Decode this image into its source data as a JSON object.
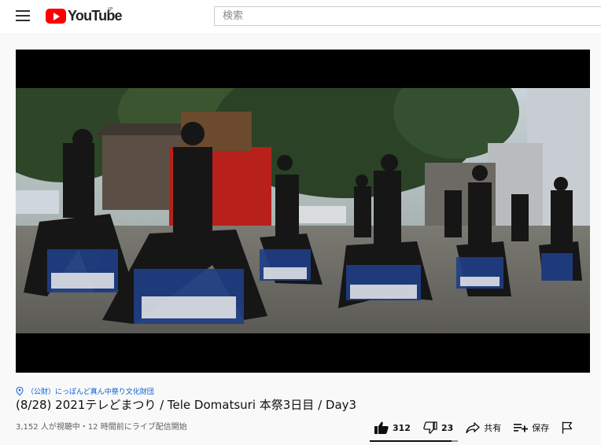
{
  "header": {
    "logo_text": "YouTube",
    "logo_region": "JP",
    "search_placeholder": "検索",
    "icons": [
      "menu-icon",
      "youtube-logo-icon"
    ]
  },
  "player": {
    "state": "playing",
    "scene": "yosakoi dancers in blue and black costumes performing in a shrine courtyard"
  },
  "video": {
    "channel": "（公財）にっぽんど真ん中祭り文化財団",
    "title": "(8/28) 2021テレどまつり / Tele Domatsuri 本祭3日目 / Day3",
    "views_line": "3,152 人が視聴中・12 時間前にライブ配信開始"
  },
  "actions": {
    "like_count": "312",
    "dislike_count": "23",
    "share_label": "共有",
    "save_label": "保存",
    "like_ratio": 0.93,
    "icons": [
      "thumb-up-icon",
      "thumb-down-icon",
      "share-icon",
      "save-playlist-icon",
      "flag-icon"
    ]
  }
}
